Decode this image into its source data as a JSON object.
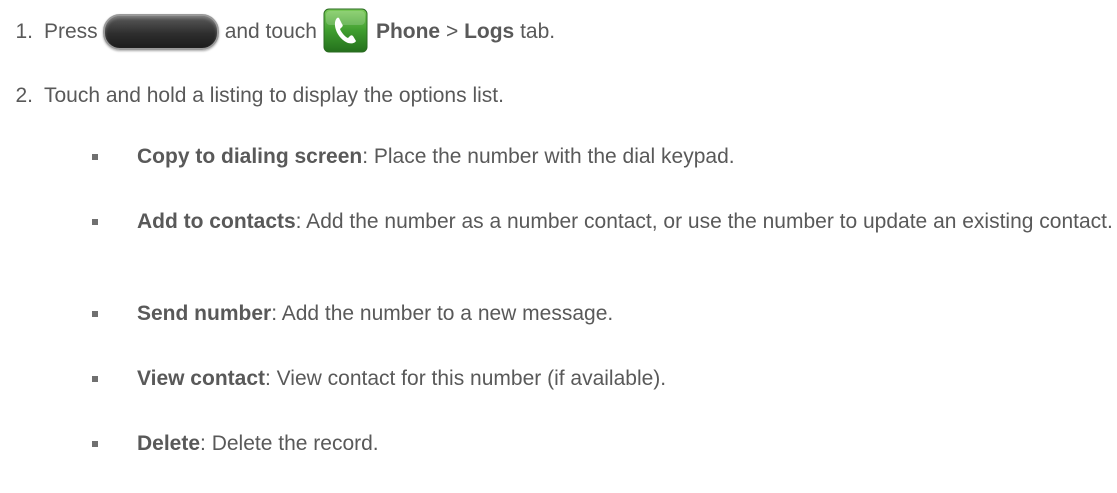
{
  "steps": [
    {
      "number": "1.",
      "press": "Press",
      "and_touch": "and touch",
      "phone_label": "Phone",
      "separator": ">",
      "logs_label": "Logs",
      "tab_word": "tab."
    },
    {
      "number": "2.",
      "text": "Touch and hold a listing to display the options list."
    }
  ],
  "options": [
    {
      "term": "Copy to dialing screen",
      "desc": ": Place the number with the dial keypad."
    },
    {
      "term": "Add to contacts",
      "desc": ": Add the number as a number contact, or use the number to update an existing contact."
    },
    {
      "term": "Send number",
      "desc": ": Add the number to a new message."
    },
    {
      "term": "View contact",
      "desc": ": View contact for this number (if available)."
    },
    {
      "term": "Delete",
      "desc": ": Delete the record."
    }
  ],
  "icons": {
    "home_key": "home-key-icon",
    "phone_app": "phone-app-icon"
  },
  "colors": {
    "text": "#595959",
    "phone_icon_green": "#3f9d2f"
  }
}
